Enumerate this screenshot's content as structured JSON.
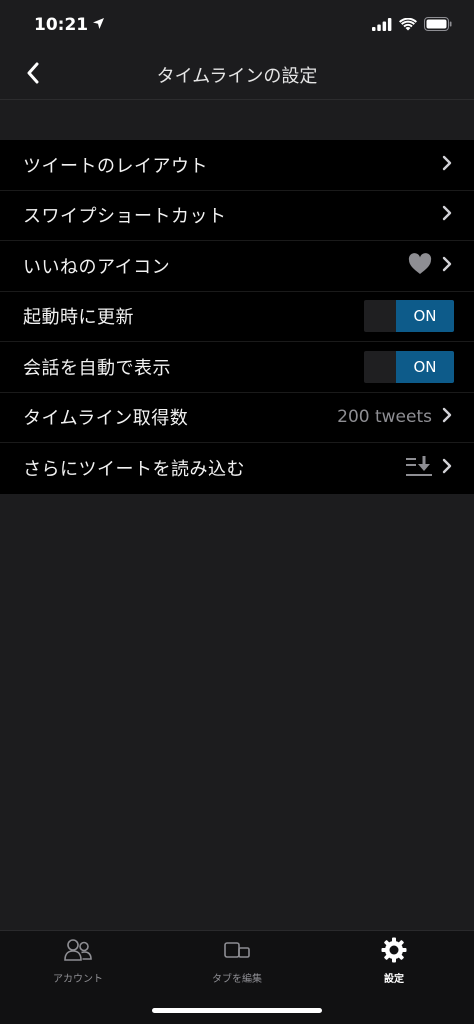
{
  "status_bar": {
    "time": "10:21"
  },
  "nav": {
    "title": "タイムラインの設定"
  },
  "settings": [
    {
      "label": "ツイートのレイアウト"
    },
    {
      "label": "スワイプショートカット"
    },
    {
      "label": "いいねのアイコン"
    },
    {
      "label": "起動時に更新",
      "toggle": "ON"
    },
    {
      "label": "会話を自動で表示",
      "toggle": "ON"
    },
    {
      "label": "タイムライン取得数",
      "value": "200 tweets"
    },
    {
      "label": "さらにツイートを読み込む"
    }
  ],
  "tabs": [
    {
      "label": "アカウント",
      "icon": "accounts-icon"
    },
    {
      "label": "タブを編集",
      "icon": "edit-tabs-icon"
    },
    {
      "label": "設定",
      "icon": "gear-icon",
      "active": true
    }
  ],
  "colors": {
    "background": "#1c1c1e",
    "list_background": "#000000",
    "toggle_on": "#0d5b8a",
    "secondary_text": "#8e8e93"
  }
}
